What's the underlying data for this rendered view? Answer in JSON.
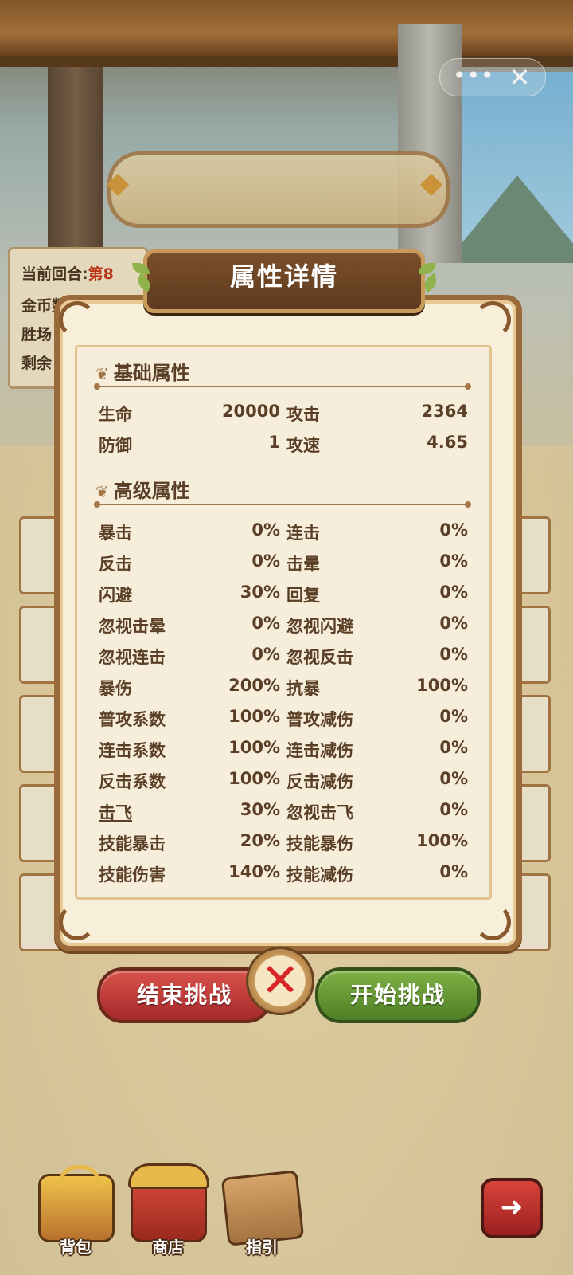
{
  "round_panel": {
    "current_round_label": "当前回合:",
    "current_round_value": "第8",
    "coins_label": "金币数:",
    "wins_label": "胜场",
    "remaining_label": "剩余"
  },
  "capsule": {
    "more_icon": "more-dots-icon",
    "close_icon": "close-icon"
  },
  "dialog": {
    "title": "属性详情",
    "basic": {
      "heading": "基础属性",
      "rows": [
        {
          "l_label": "生命",
          "l_val": "20000",
          "r_label": "攻击",
          "r_val": "2364"
        },
        {
          "l_label": "防御",
          "l_val": "1",
          "r_label": "攻速",
          "r_val": "4.65"
        }
      ]
    },
    "advanced": {
      "heading": "高级属性",
      "rows": [
        {
          "l_label": "暴击",
          "l_val": "0%",
          "r_label": "连击",
          "r_val": "0%"
        },
        {
          "l_label": "反击",
          "l_val": "0%",
          "r_label": "击晕",
          "r_val": "0%"
        },
        {
          "l_label": "闪避",
          "l_val": "30%",
          "r_label": "回复",
          "r_val": "0%"
        },
        {
          "l_label": "忽视击晕",
          "l_val": "0%",
          "r_label": "忽视闪避",
          "r_val": "0%"
        },
        {
          "l_label": "忽视连击",
          "l_val": "0%",
          "r_label": "忽视反击",
          "r_val": "0%"
        },
        {
          "l_label": "暴伤",
          "l_val": "200%",
          "r_label": "抗暴",
          "r_val": "100%"
        },
        {
          "l_label": "普攻系数",
          "l_val": "100%",
          "r_label": "普攻减伤",
          "r_val": "0%"
        },
        {
          "l_label": "连击系数",
          "l_val": "100%",
          "r_label": "连击减伤",
          "r_val": "0%"
        },
        {
          "l_label": "反击系数",
          "l_val": "100%",
          "r_label": "反击减伤",
          "r_val": "0%"
        },
        {
          "l_label": "击飞",
          "l_val": "30%",
          "r_label": "忽视击飞",
          "r_val": "0%"
        },
        {
          "l_label": "技能暴击",
          "l_val": "20%",
          "r_label": "技能暴伤",
          "r_val": "100%"
        },
        {
          "l_label": "技能伤害",
          "l_val": "140%",
          "r_label": "技能减伤",
          "r_val": "0%"
        }
      ]
    }
  },
  "actions": {
    "end_label": "结束挑战",
    "start_label": "开始挑战",
    "close_icon": "close-x-icon"
  },
  "nav": {
    "bag_label": "背包",
    "shop_label": "商店",
    "guide_label": "指引",
    "exit_icon": "exit-icon"
  },
  "colors": {
    "panel_bg": "#f6eedb",
    "frame_brown": "#9a6a3a",
    "text_brown": "#5a3e26",
    "end_red": "#c23a36",
    "start_green": "#6a9a36",
    "highlight_red": "#c4381c"
  }
}
